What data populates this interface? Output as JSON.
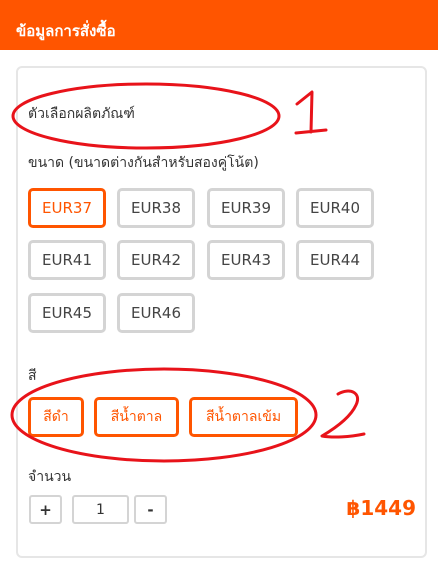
{
  "header": {
    "title": "ข้อมูลการสั่งซื้อ"
  },
  "options_section": {
    "title": "ตัวเลือกผลิตภัณฑ์"
  },
  "size": {
    "label": "ขนาด (ขนาดต่างกันสำหรับสองคู่โน้ต)",
    "selected": "EUR37",
    "options": [
      "EUR37",
      "EUR38",
      "EUR39",
      "EUR40",
      "EUR41",
      "EUR42",
      "EUR43",
      "EUR44",
      "EUR45",
      "EUR46"
    ]
  },
  "color": {
    "label": "สี",
    "options": [
      "สีดำ",
      "สีน้ำตาล",
      "สีน้ำตาลเข้ม"
    ]
  },
  "quantity": {
    "label": "จำนวน",
    "plus": "+",
    "value": "1",
    "minus": "-"
  },
  "price": "฿1449",
  "annotations": {
    "mark1": "1",
    "mark2": "2",
    "color": "#e8131a"
  },
  "colors": {
    "accent": "#ff5500",
    "border": "#d4d4d4"
  }
}
